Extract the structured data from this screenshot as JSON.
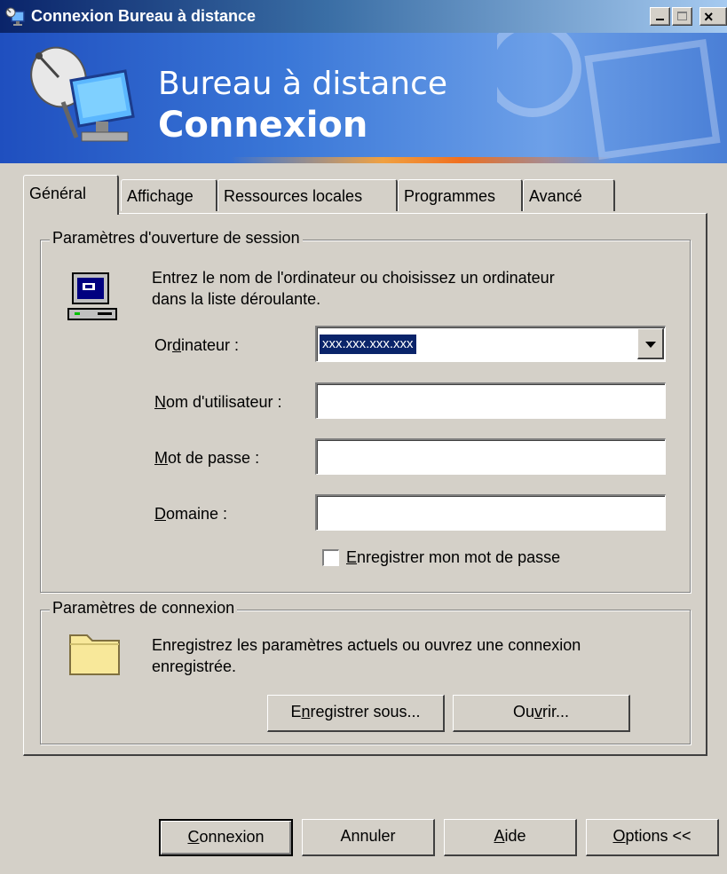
{
  "window": {
    "title": "Connexion Bureau à distance",
    "minimize_glyph": "_",
    "maximize_glyph": "□",
    "close_glyph": "×"
  },
  "banner": {
    "line1": "Bureau à distance",
    "line2": "Connexion"
  },
  "tabs": [
    {
      "label": "Général",
      "active": true
    },
    {
      "label": "Affichage",
      "active": false
    },
    {
      "label": "Ressources locales",
      "active": false
    },
    {
      "label": "Programmes",
      "active": false
    },
    {
      "label": "Avancé",
      "active": false
    }
  ],
  "logon": {
    "legend": "Paramètres d'ouverture de session",
    "description_line1": "Entrez le nom de l'ordinateur ou choisissez un ordinateur",
    "description_line2": "dans la liste déroulante.",
    "computer_label": "Ordinateur :",
    "computer_value": "xxx.xxx.xxx.xxx",
    "username_label": "Nom d'utilisateur :",
    "username_value": "",
    "password_label": "Mot de passe :",
    "password_value": "",
    "domain_label": "Domaine :",
    "domain_value": "",
    "save_password_label": "Enregistrer mon mot de passe",
    "save_password_checked": false
  },
  "connection": {
    "legend": "Paramètres de connexion",
    "description_line1": "Enregistrez les paramètres actuels ou ouvrez une connexion",
    "description_line2": "enregistrée.",
    "save_as_label": "Enregistrer sous...",
    "open_label": "Ouvrir..."
  },
  "buttons": {
    "connect": "Connexion",
    "cancel": "Annuler",
    "help": "Aide",
    "options": "Options <<"
  },
  "icons": [
    "remote-desktop-icon",
    "computer-icon",
    "folder-icon",
    "satellite-dish-icon"
  ],
  "colors": {
    "titlebar_start": "#0a246a",
    "titlebar_end": "#a6caf0",
    "banner": "#3b78d8",
    "face": "#d4d0c8",
    "selection": "#0a246a"
  }
}
